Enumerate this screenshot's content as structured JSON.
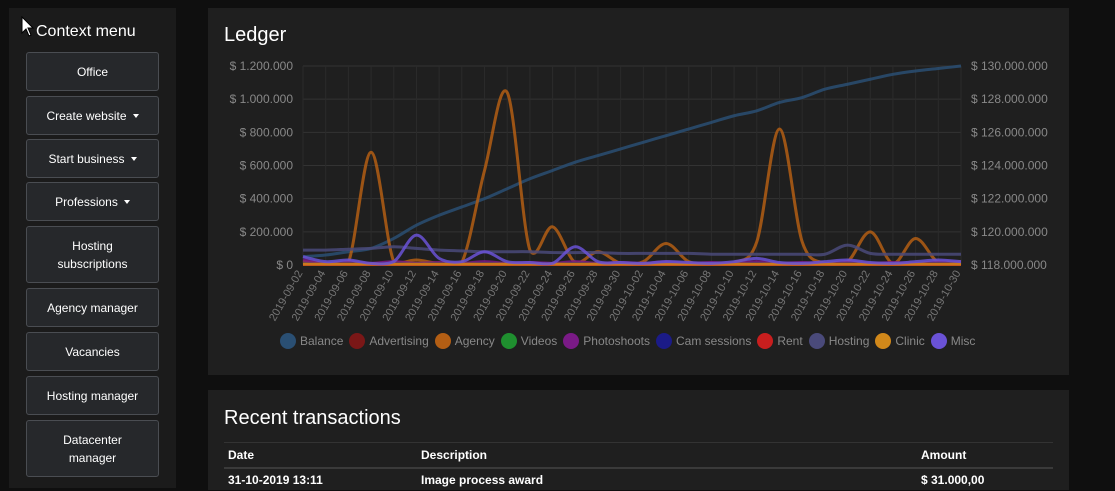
{
  "sidebar": {
    "title": "Context menu",
    "items": [
      {
        "label": "Office",
        "dropdown": false
      },
      {
        "label": "Create website",
        "dropdown": true
      },
      {
        "label": "Start business",
        "dropdown": true
      },
      {
        "label": "Professions",
        "dropdown": true
      },
      {
        "label": "Hosting subscriptions",
        "dropdown": false
      },
      {
        "label": "Agency manager",
        "dropdown": false
      },
      {
        "label": "Vacancies",
        "dropdown": false
      },
      {
        "label": "Hosting manager",
        "dropdown": false
      },
      {
        "label": "Datacenter manager",
        "dropdown": false
      }
    ]
  },
  "ledger": {
    "title": "Ledger"
  },
  "chart_data": {
    "type": "line",
    "title": "Ledger",
    "categories": [
      "2019-09-02",
      "2019-09-04",
      "2019-09-06",
      "2019-09-08",
      "2019-09-10",
      "2019-09-12",
      "2019-09-14",
      "2019-09-16",
      "2019-09-18",
      "2019-09-20",
      "2019-09-22",
      "2019-09-24",
      "2019-09-26",
      "2019-09-28",
      "2019-09-30",
      "2019-10-02",
      "2019-10-04",
      "2019-10-06",
      "2019-10-08",
      "2019-10-10",
      "2019-10-12",
      "2019-10-14",
      "2019-10-16",
      "2019-10-18",
      "2019-10-20",
      "2019-10-22",
      "2019-10-24",
      "2019-10-26",
      "2019-10-28",
      "2019-10-30"
    ],
    "left_axis": {
      "ticks": [
        "$ 0",
        "$ 200.000",
        "$ 400.000",
        "$ 600.000",
        "$ 800.000",
        "$ 1.000.000",
        "$ 1.200.000"
      ],
      "ylim": [
        0,
        1200000
      ]
    },
    "right_axis": {
      "ticks": [
        "$ 118.000.000",
        "$ 120.000.000",
        "$ 122.000.000",
        "$ 124.000.000",
        "$ 126.000.000",
        "$ 128.000.000",
        "$ 130.000.000"
      ],
      "ylim": [
        118000000,
        130000000
      ]
    },
    "series": [
      {
        "name": "Balance",
        "color": "#2a4f73",
        "axis": "right",
        "values": [
          118500000,
          118600000,
          118800000,
          119000000,
          119600000,
          120400000,
          121000000,
          121500000,
          122000000,
          122600000,
          123200000,
          123700000,
          124200000,
          124600000,
          125000000,
          125400000,
          125800000,
          126200000,
          126600000,
          127000000,
          127300000,
          127800000,
          128100000,
          128600000,
          128900000,
          129200000,
          129500000,
          129700000,
          129850000,
          130000000
        ]
      },
      {
        "name": "Advertising",
        "color": "#7a1717",
        "axis": "left",
        "values": [
          10000,
          5000,
          8000,
          5000,
          10000,
          5000,
          12000,
          5000,
          8000,
          5000,
          10000,
          5000,
          6000,
          5000,
          8000,
          5000,
          10000,
          5000,
          6000,
          5000,
          10000,
          5000,
          8000,
          5000,
          10000,
          5000,
          6000,
          5000,
          8000,
          10000
        ]
      },
      {
        "name": "Agency",
        "color": "#b35e14",
        "axis": "left",
        "values": [
          20000,
          10000,
          15000,
          680000,
          20000,
          30000,
          10000,
          15000,
          570000,
          1040000,
          90000,
          230000,
          15000,
          80000,
          10000,
          20000,
          130000,
          20000,
          10000,
          15000,
          140000,
          820000,
          140000,
          10000,
          20000,
          200000,
          10000,
          160000,
          15000,
          20000
        ]
      },
      {
        "name": "Videos",
        "color": "#1f8f2f",
        "axis": "left",
        "values": [
          5000,
          5000,
          5000,
          5000,
          5000,
          5000,
          5000,
          5000,
          5000,
          5000,
          5000,
          5000,
          5000,
          5000,
          5000,
          5000,
          5000,
          5000,
          5000,
          5000,
          5000,
          5000,
          5000,
          5000,
          5000,
          5000,
          5000,
          5000,
          5000,
          5000
        ]
      },
      {
        "name": "Photoshoots",
        "color": "#7a1a86",
        "axis": "left",
        "values": [
          30000,
          10000,
          20000,
          10000,
          20000,
          10000,
          15000,
          10000,
          20000,
          10000,
          15000,
          10000,
          20000,
          10000,
          15000,
          10000,
          20000,
          10000,
          15000,
          10000,
          20000,
          10000,
          15000,
          10000,
          20000,
          10000,
          15000,
          10000,
          20000,
          15000
        ]
      },
      {
        "name": "Cam sessions",
        "color": "#1b1b87",
        "axis": "left",
        "values": [
          8000,
          6000,
          8000,
          6000,
          8000,
          6000,
          8000,
          6000,
          8000,
          6000,
          8000,
          6000,
          8000,
          6000,
          8000,
          6000,
          8000,
          6000,
          8000,
          6000,
          8000,
          6000,
          8000,
          6000,
          8000,
          6000,
          8000,
          6000,
          8000,
          6000
        ]
      },
      {
        "name": "Rent",
        "color": "#c81e1e",
        "axis": "left",
        "values": [
          3000,
          3000,
          3000,
          3000,
          3000,
          3000,
          3000,
          3000,
          3000,
          3000,
          3000,
          3000,
          3000,
          3000,
          3000,
          3000,
          3000,
          3000,
          3000,
          3000,
          3000,
          3000,
          3000,
          3000,
          3000,
          3000,
          3000,
          3000,
          3000,
          3000
        ]
      },
      {
        "name": "Hosting",
        "color": "#4a4a7a",
        "axis": "left",
        "values": [
          90000,
          90000,
          95000,
          100000,
          110000,
          100000,
          90000,
          85000,
          80000,
          80000,
          80000,
          75000,
          75000,
          75000,
          70000,
          70000,
          70000,
          70000,
          65000,
          65000,
          65000,
          65000,
          65000,
          65000,
          120000,
          70000,
          65000,
          65000,
          65000,
          65000
        ]
      },
      {
        "name": "Clinic",
        "color": "#d1881a",
        "axis": "left",
        "values": [
          5000,
          5000,
          5000,
          5000,
          5000,
          5000,
          5000,
          5000,
          5000,
          5000,
          5000,
          5000,
          5000,
          5000,
          5000,
          5000,
          5000,
          5000,
          5000,
          5000,
          5000,
          5000,
          5000,
          5000,
          5000,
          5000,
          5000,
          5000,
          5000,
          5000
        ]
      },
      {
        "name": "Misc",
        "color": "#6a52d6",
        "axis": "left",
        "values": [
          50000,
          20000,
          30000,
          10000,
          20000,
          180000,
          40000,
          20000,
          80000,
          20000,
          15000,
          10000,
          110000,
          20000,
          15000,
          10000,
          20000,
          15000,
          10000,
          20000,
          40000,
          15000,
          10000,
          20000,
          30000,
          15000,
          10000,
          20000,
          30000,
          20000
        ]
      }
    ]
  },
  "transactions": {
    "title": "Recent transactions",
    "headers": [
      "Date",
      "Description",
      "Amount"
    ],
    "rows": [
      {
        "date": "31-10-2019 13:11",
        "description": "Image process award",
        "amount": "$ 31.000,00"
      }
    ]
  }
}
